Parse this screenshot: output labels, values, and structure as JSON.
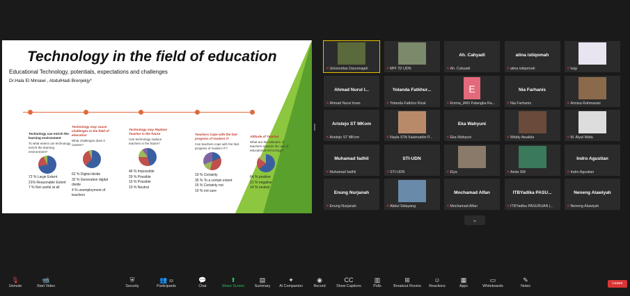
{
  "slide": {
    "title": "Technology in the field of education",
    "subtitle": "Educational Technology, potentials, expectations and challenges",
    "authors": "Dr.Hala El Miniawi , AbdulHadi Brenjekjy*",
    "columns": [
      {
        "heading": "Technology can enrich the learning environment",
        "heading_red": false,
        "question": "To what extent can technology enrich the learning environment?",
        "results": [
          "72 % Large Extent",
          "21% Reasonable Extent",
          "7 % Not useful at all"
        ]
      },
      {
        "heading": "Technology may cause challenges in the field of education",
        "heading_red": true,
        "question": "What challenges does it causes?",
        "results": [
          "62 % Digital divide",
          "32 % Generation digital divide",
          "4 % unemployment of teachers"
        ]
      },
      {
        "heading": "Technology may Replace Teacher in the future",
        "heading_red": true,
        "question": "Can technology replace teachers in the future?",
        "results": [
          "46 % Impossible",
          "29 % Possible",
          "15 % Possible",
          "10 % Neutral"
        ]
      },
      {
        "heading": "Teachers Cope with the fast progress of modern IT",
        "heading_red": true,
        "question": "Can teachers cope with the fast progress of modern IT?",
        "results": [
          "19 % Certainly",
          "35 % To a certain extent",
          "15 % Certainly not",
          "10 % not sure"
        ]
      },
      {
        "heading": "Attitude of Teacher",
        "heading_red": true,
        "question": "What are the attitudes of teachers towards the use of educational technology?",
        "results": [
          "64 % positive",
          "21 % negative",
          "14 % neutral"
        ]
      }
    ]
  },
  "participants": [
    {
      "name": "",
      "label": "Universitas Darunnajah",
      "photo": "#5a6a3a"
    },
    {
      "name": "",
      "label": "MPI 7D UDN",
      "photo": "#7a8a6a"
    },
    {
      "name": "Ah. Cahyadi",
      "label": "Ah. Cahyadi",
      "photo": ""
    },
    {
      "name": "atina istiqomah",
      "label": "atina istiqomah",
      "photo": ""
    },
    {
      "name": "",
      "label": "luqy",
      "photo": "#e8e4f0"
    },
    {
      "name": "Ahmad Nurul I...",
      "label": "Ahmad Nurul Iman",
      "photo": ""
    },
    {
      "name": "Yolanda Fatkhur...",
      "label": "Yolanda Fatkhur Rizal",
      "photo": ""
    },
    {
      "name": "",
      "label": "Emma_IAIN Palangka Ra...",
      "photo": "avatar-e"
    },
    {
      "name": "Nia Farhanis",
      "label": "Nia Farhanis",
      "photo": ""
    },
    {
      "name": "",
      "label": "Annisa Rahmasari",
      "photo": "#8a6a4a"
    },
    {
      "name": "Aristejo ST MKom",
      "label": "Aristejo ST MKom",
      "photo": ""
    },
    {
      "name": "",
      "label": "Nayla STA Salahuddin P...",
      "photo": "#b98a6a"
    },
    {
      "name": "Eka Wahyuni",
      "label": "Eka Wahyuni",
      "photo": ""
    },
    {
      "name": "",
      "label": "Widdy Awalida",
      "photo": "#6a4a3a"
    },
    {
      "name": "",
      "label": "M. Alyal Wafa",
      "photo": "#ddd"
    },
    {
      "name": "Muhamad fadhli",
      "label": "Muhamad fadhli",
      "photo": ""
    },
    {
      "name": "STI-UDN",
      "label": "STI-UDN",
      "photo": ""
    },
    {
      "name": "",
      "label": "Elya",
      "photo": "#8a7a6a"
    },
    {
      "name": "",
      "label": "Anda SM",
      "photo": "#3a7a5a"
    },
    {
      "name": "Indro Agustian",
      "label": "Indro Agustian",
      "photo": ""
    },
    {
      "name": "Enung Nurjanah",
      "label": "Enung Nurjanah",
      "photo": ""
    },
    {
      "name": "",
      "label": "Abdul Sidayang",
      "photo": "#6a8aaa"
    },
    {
      "name": "Mochamad Alfan",
      "label": "Mochamad Alfan",
      "photo": ""
    },
    {
      "name": "ITBYadika PASU...",
      "label": "ITBYadika PASURUAN |...",
      "photo": ""
    },
    {
      "name": "Neneng Alawiyah",
      "label": "Neneng Alawiyah",
      "photo": ""
    }
  ],
  "avatar_letter": "E",
  "chevron": "⌄",
  "toolbar": {
    "unmute": "Unmute",
    "start_video": "Start Video",
    "security": "Security",
    "participants": "Participants",
    "participants_count": "53",
    "chat": "Chat",
    "share_screen": "Share Screen",
    "summary": "Summary",
    "ai_companion": "AI Companion",
    "record": "Record",
    "show_captions": "Show Captions",
    "polls": "Polls",
    "breakout_rooms": "Breakout Rooms",
    "reactions": "Reactions",
    "apps": "Apps",
    "whiteboards": "Whiteboards",
    "notes": "Notes",
    "leave": "Leave"
  }
}
